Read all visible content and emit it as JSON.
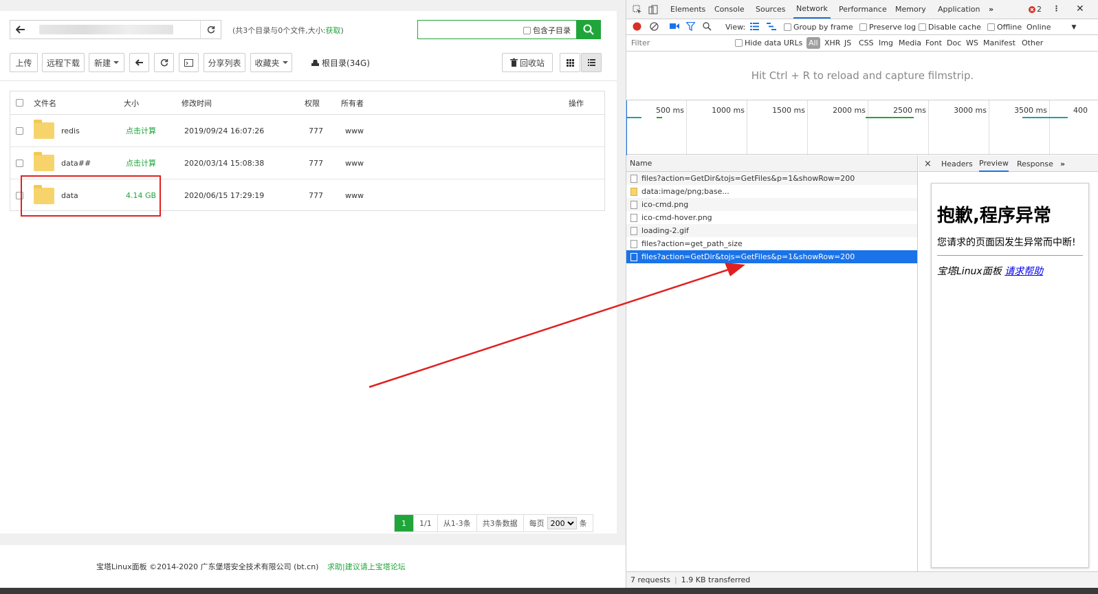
{
  "panel": {
    "path_summary_prefix": "(共3个目录与0个文件,大小:",
    "path_summary_link": "获取",
    "path_summary_suffix": ")",
    "search_sub_label": "包含子目录",
    "toolbar": {
      "upload": "上传",
      "remote_download": "远程下载",
      "new": "新建",
      "share_list": "分享列表",
      "favorites": "收藏夹",
      "root_dir": "根目录(34G)",
      "recycle_bin": "回收站"
    },
    "table": {
      "headers": {
        "name": "文件名",
        "size": "大小",
        "mtime": "修改时间",
        "perm": "权限",
        "owner": "所有者",
        "ops": "操作"
      },
      "rows": [
        {
          "name": "redis",
          "size": "点击计算",
          "mtime": "2019/09/24 16:07:26",
          "perm": "777",
          "owner": "www"
        },
        {
          "name": "data##",
          "size": "点击计算",
          "mtime": "2020/03/14 15:08:38",
          "perm": "777",
          "owner": "www"
        },
        {
          "name": "data",
          "size": "4.14 GB",
          "mtime": "2020/06/15 17:29:19",
          "perm": "777",
          "owner": "www"
        }
      ]
    },
    "pager": {
      "current": "1",
      "pages": "1/1",
      "range": "从1-3条",
      "total": "共3条数据",
      "per_page_prefix": "每页",
      "per_page_value": "200",
      "per_page_suffix": "条"
    },
    "footer": {
      "copyright": "宝塔Linux面板 ©2014-2020 广东堡塔安全技术有限公司 (bt.cn)",
      "help_link": "求助|建议请上宝塔论坛"
    }
  },
  "devtools": {
    "tabs": [
      "Elements",
      "Console",
      "Sources",
      "Network",
      "Performance",
      "Memory",
      "Application"
    ],
    "active_tab": "Network",
    "error_count": "2",
    "toolbar": {
      "view": "View:",
      "group_by_frame": "Group by frame",
      "preserve_log": "Preserve log",
      "disable_cache": "Disable cache",
      "offline": "Offline",
      "online": "Online"
    },
    "filter_bar": {
      "placeholder": "Filter",
      "hide_data_urls": "Hide data URLs",
      "types": [
        "All",
        "XHR",
        "JS",
        "CSS",
        "Img",
        "Media",
        "Font",
        "Doc",
        "WS",
        "Manifest",
        "Other"
      ]
    },
    "filmstrip_message": "Hit Ctrl + R to reload and capture filmstrip.",
    "timeline_ticks": [
      "500 ms",
      "1000 ms",
      "1500 ms",
      "2000 ms",
      "2500 ms",
      "3000 ms",
      "3500 ms",
      "400"
    ],
    "requests_header": "Name",
    "requests": [
      "files?action=GetDir&tojs=GetFiles&p=1&showRow=200",
      "data:image/png;base...",
      "ico-cmd.png",
      "ico-cmd-hover.png",
      "loading-2.gif",
      "files?action=get_path_size",
      "files?action=GetDir&tojs=GetFiles&p=1&showRow=200"
    ],
    "selected_request_index": 6,
    "detail_tabs": [
      "Headers",
      "Preview",
      "Response"
    ],
    "active_detail_tab": "Preview",
    "preview": {
      "title": "抱歉,程序异常",
      "message": "您请求的页面因发生异常而中断!",
      "signature": "宝塔Linux面板",
      "help_link": "请求帮助"
    },
    "status": {
      "requests": "7 requests",
      "transferred": "1.9 KB transferred"
    }
  },
  "colors": {
    "bt_green": "#20a53a",
    "devtools_blue": "#1a73e8",
    "annotation_red": "#e02020"
  }
}
